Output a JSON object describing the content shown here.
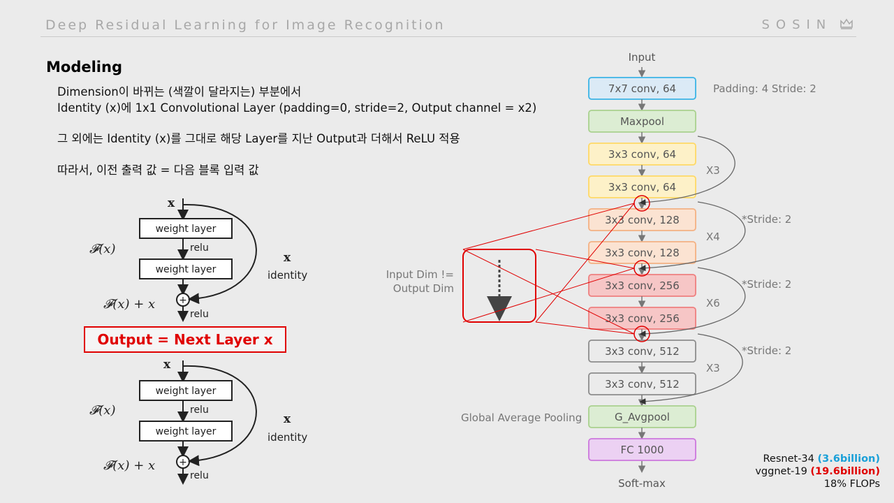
{
  "header": {
    "title": "Deep Residual Learning for Image Recognition",
    "brand": "SOSIN",
    "brand_icon": "crown-icon"
  },
  "section_title": "Modeling",
  "body_lines": [
    "Dimension이 바뀌는 (색깔이 달라지는) 부분에서",
    "Identity (x)에 1x1 Convolutional Layer (padding=0, stride=2, Output channel = x2)",
    "그 외에는 Identity (x)를 그대로 해당 Layer를 지난 Output과 더해서 ReLU 적용",
    "따라서, 이전 출력 값 = 다음 블록 입력 값"
  ],
  "residual_block": {
    "input": "x",
    "layer_label": "weight layer",
    "relu": "relu",
    "fx": "𝓕(x)",
    "fx_plus_x": "𝓕(x) + x",
    "identity_x": "x",
    "identity": "identity",
    "plus": "+"
  },
  "output_box": "Output = Next Layer x",
  "network": {
    "input_label": "Input",
    "output_label": "Soft-max",
    "nodes": [
      {
        "label": "7x7 conv, 64",
        "fill": "#dbeaf6",
        "stroke": "#3ab4e6"
      },
      {
        "label": "Maxpool",
        "fill": "#dcedd3",
        "stroke": "#a9d18e"
      },
      {
        "label": "3x3 conv, 64",
        "fill": "#fdf1c8",
        "stroke": "#ffd966"
      },
      {
        "label": "3x3 conv, 64",
        "fill": "#fdf1c8",
        "stroke": "#ffd966"
      },
      {
        "label": "3x3 conv, 128",
        "fill": "#fbe3d2",
        "stroke": "#f4b183"
      },
      {
        "label": "3x3 conv, 128",
        "fill": "#fbe3d2",
        "stroke": "#f4b183"
      },
      {
        "label": "3x3 conv, 256",
        "fill": "#f6c6c6",
        "stroke": "#ee7f7f"
      },
      {
        "label": "3x3 conv, 256",
        "fill": "#f6c6c6",
        "stroke": "#ee7f7f"
      },
      {
        "label": "3x3 conv, 512",
        "fill": "#ebebeb",
        "stroke": "#8c8c8c"
      },
      {
        "label": "3x3 conv, 512",
        "fill": "#ebebeb",
        "stroke": "#8c8c8c"
      },
      {
        "label": "G_Avgpool",
        "fill": "#dcedd3",
        "stroke": "#a9d18e"
      },
      {
        "label": "FC 1000",
        "fill": "#ecd1f3",
        "stroke": "#cc77dd"
      }
    ],
    "padding_note": "Padding: 4 Stride: 2",
    "repeats": [
      "X3",
      "X4",
      "X6",
      "X3"
    ],
    "stride_notes": [
      "*Stride: 2",
      "*Stride: 2",
      "*Stride: 2"
    ],
    "gap_label": "Global Average Pooling",
    "dim_label_1": "Input Dim !=",
    "dim_label_2": "Output Dim"
  },
  "flops": {
    "resnet_name": "Resnet-34",
    "resnet_value": "(3.6billion)",
    "vgg_name": "vggnet-19",
    "vgg_value": "(19.6billion)",
    "ratio": "18% FLOPs"
  },
  "colors": {
    "accent_red": "#e00000",
    "accent_blue": "#1aa0d8"
  }
}
